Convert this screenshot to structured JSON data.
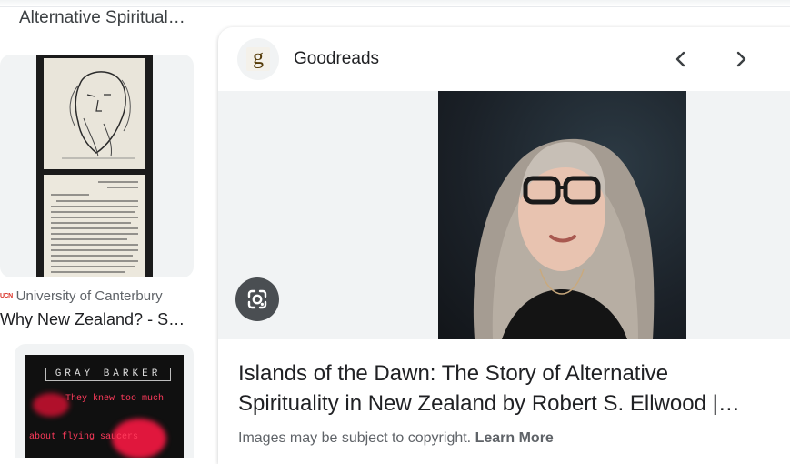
{
  "left_column": {
    "top_result_title": "Alternative Spiritual…",
    "result1": {
      "source": "University of Canterbury",
      "source_logo": "UCN",
      "title": "Why New Zealand? - S…"
    },
    "result2": {
      "cover_header": "GRAY BARKER",
      "cover_line1": "They knew too much",
      "cover_line2": "about flying saucers"
    }
  },
  "panel": {
    "site_favicon_letter": "g",
    "site_name": "Goodreads",
    "prev_icon": "chevron-left-icon",
    "next_icon": "chevron-right-icon",
    "lens_icon": "google-lens-icon",
    "title": "Islands of the Dawn: The Story of Alternative Spirituality in New Zealand by Robert S. Ellwood |…",
    "copyright_text": "Images may be subject to copyright.",
    "learn_more": "Learn More"
  },
  "colors": {
    "image_background": "#f1f3f4",
    "lens_button": "#3c4043",
    "text_primary": "#202124",
    "text_secondary": "#5f6368"
  }
}
